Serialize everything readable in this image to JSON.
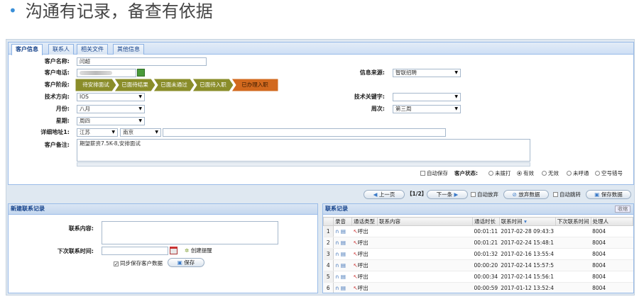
{
  "slide": {
    "bullet": "•",
    "title": "沟通有记录，备查有依据"
  },
  "tabs": [
    "客户信息",
    "联系人",
    "相关文件",
    "其他信息"
  ],
  "form": {
    "name_label": "客户名称:",
    "name_value": "闫超",
    "phone_label": "客户电话:",
    "source_label": "信息来源:",
    "source_value": "智联招聘",
    "stage_label": "客户阶段:",
    "stages": [
      "待安排面试",
      "已面待结果",
      "已面未通过",
      "已面待入职",
      "已办理入职"
    ],
    "tech_label": "技术方向:",
    "tech_value": "IOS",
    "keyword_label": "技术关键字:",
    "keyword_value": "",
    "month_label": "月份:",
    "month_value": "八月",
    "week_label": "周次:",
    "week_value": "第三周",
    "weekday_label": "星期:",
    "weekday_value": "周四",
    "address_label": "详细地址1:",
    "province_value": "江苏",
    "city_value": "南京",
    "address_value": "",
    "remark_label": "客户备注:",
    "remark_value": "期望薪资7.5K-8,安排面试"
  },
  "status_bar": {
    "auto_save": "自动保存",
    "status_label": "客户状态:",
    "options": [
      "未拨打",
      "有效",
      "无效",
      "未呼通",
      "空号错号"
    ],
    "selected": "有效"
  },
  "toolbar": {
    "prev": "上一页",
    "page": "【1/2】",
    "next": "下一条",
    "auto_abandon": "自动放弃",
    "abandon_data": "放弃数据",
    "auto_jump": "自动跳转",
    "save_data": "保存数据"
  },
  "new_contact": {
    "title": "新建联系记录",
    "content_label": "联系内容:",
    "next_time_label": "下次联系时间:",
    "create_reminder": "创建提醒",
    "sync_save": "同步保存客户数据",
    "save": "保存"
  },
  "contact_records": {
    "title": "联系记录",
    "collapse": "收缩",
    "columns": [
      "录音",
      "通话类型",
      "联系内容",
      "通话时长",
      "联系时间",
      "下次联系时间",
      "处理人"
    ],
    "rows": [
      {
        "num": "1",
        "type": "呼出",
        "content": "",
        "duration": "00:01:11",
        "time": "2017-02-28 09:43:3",
        "next": "",
        "handler": "8004"
      },
      {
        "num": "2",
        "type": "呼出",
        "content": "",
        "duration": "00:01:21",
        "time": "2017-02-24 15:48:1",
        "next": "",
        "handler": "8004"
      },
      {
        "num": "3",
        "type": "呼出",
        "content": "",
        "duration": "00:01:32",
        "time": "2017-02-16 13:55:4",
        "next": "",
        "handler": "8004"
      },
      {
        "num": "4",
        "type": "呼出",
        "content": "",
        "duration": "00:00:20",
        "time": "2017-02-14 15:57:5",
        "next": "",
        "handler": "8004"
      },
      {
        "num": "5",
        "type": "呼出",
        "content": "",
        "duration": "00:00:34",
        "time": "2017-02-14 15:56:1",
        "next": "",
        "handler": "8004"
      },
      {
        "num": "6",
        "type": "呼出",
        "content": "",
        "duration": "00:00:59",
        "time": "2017-01-12 13:52:4",
        "next": "",
        "handler": "8004"
      }
    ]
  },
  "colors": {
    "stage_done": "#8a8d2a",
    "stage_current": "#d2691e",
    "header_blue": "#15428b",
    "border_blue": "#99bbe8"
  }
}
